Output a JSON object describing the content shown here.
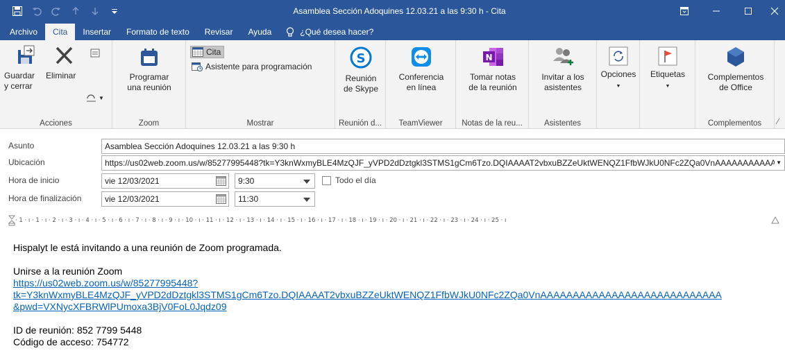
{
  "window": {
    "title": "Asamblea Sección Adoquines 12.03.21 a las 9:30 h  -  Cita"
  },
  "colors": {
    "accent": "#2b579a",
    "ribbon": "#f3f3f3",
    "link": "#0563c1"
  },
  "menu": {
    "tabs": [
      "Archivo",
      "Cita",
      "Insertar",
      "Formato de texto",
      "Revisar",
      "Ayuda"
    ],
    "tell_me": "¿Qué desea hacer?"
  },
  "ribbon": {
    "acciones": {
      "label": "Acciones",
      "save_close_1": "Guardar",
      "save_close_2": "y cerrar",
      "delete": "Eliminar"
    },
    "zoom": {
      "label": "Zoom",
      "schedule_1": "Programar",
      "schedule_2": "una reunión"
    },
    "mostrar": {
      "label": "Mostrar",
      "cita": "Cita",
      "assistant": "Asistente para programación"
    },
    "skype": {
      "label": "Reunión d...",
      "btn_1": "Reunión",
      "btn_2": "de Skype"
    },
    "teamviewer": {
      "label": "TeamViewer",
      "btn_1": "Conferencia",
      "btn_2": "en línea"
    },
    "onenote": {
      "label": "Notas de la reu...",
      "btn_1": "Tomar notas",
      "btn_2": "de la reunión"
    },
    "asistentes": {
      "label": "Asistentes",
      "btn_1": "Invitar a los",
      "btn_2": "asistentes"
    },
    "opciones": {
      "btn": "Opciones"
    },
    "etiquetas": {
      "btn": "Etiquetas"
    },
    "complementos": {
      "label": "Complementos",
      "btn_1": "Complementos",
      "btn_2": "de Office"
    }
  },
  "form": {
    "subject_label": "Asunto",
    "subject_value": "Asamblea Sección Adoquines 12.03.21 a las 9:30 h",
    "location_label": "Ubicación",
    "location_value": "https://us02web.zoom.us/w/85277995448?tk=Y3knWxmyBLE4MzQJF_yVPD2dDztgkl3STMS1gCm6Tzo.DQIAAAAT2vbxuBZZeUktWENQZ1FfbWJkU0NFc2ZQa0VnAAAAAAAAAAA",
    "start_label": "Hora de inicio",
    "start_date": "vie 12/03/2021",
    "start_time": "9:30",
    "allday_label": "Todo el día",
    "end_label": "Hora de finalización",
    "end_date": "vie 12/03/2021",
    "end_time": "11:30"
  },
  "ruler": "· 1 · ı · 1 · ı · 2 · ı · 3 · ı · 4 · ı · 5 · ı · 6 · ı · 7 · ı · 8 · ı · 9 · ı · 10 · ı · 11 · ı · 12 · ı · 13 · ı · 14 · ı · 15 · ı · 16 · ı · 17 · ı · 18 · ı · 19 · ı · 20 · ı · 21 · ı · 22 · ı · 23 · ı · 24 · ı · 25 · ı",
  "body": {
    "intro": "Hispalyt le está invitando a una reunión de Zoom programada.",
    "join_title": "Unirse a la reunión Zoom",
    "link_line1": "https://us02web.zoom.us/w/85277995448?",
    "link_line2": "tk=Y3knWxmyBLE4MzQJF_yVPD2dDztgkl3STMS1gCm6Tzo.DQIAAAAT2vbxuBZZeUktWENQZ1FfbWJkU0NFc2ZQa0VnAAAAAAAAAAAAAAAAAAAAAAAAAAAA",
    "link_line3": "&pwd=VXNycXFBRWlPUmoxa3BjV0FoL0Jqdz09",
    "meeting_id": "ID de reunión: 852 7799 5448",
    "passcode": "Código de acceso: 754772"
  }
}
